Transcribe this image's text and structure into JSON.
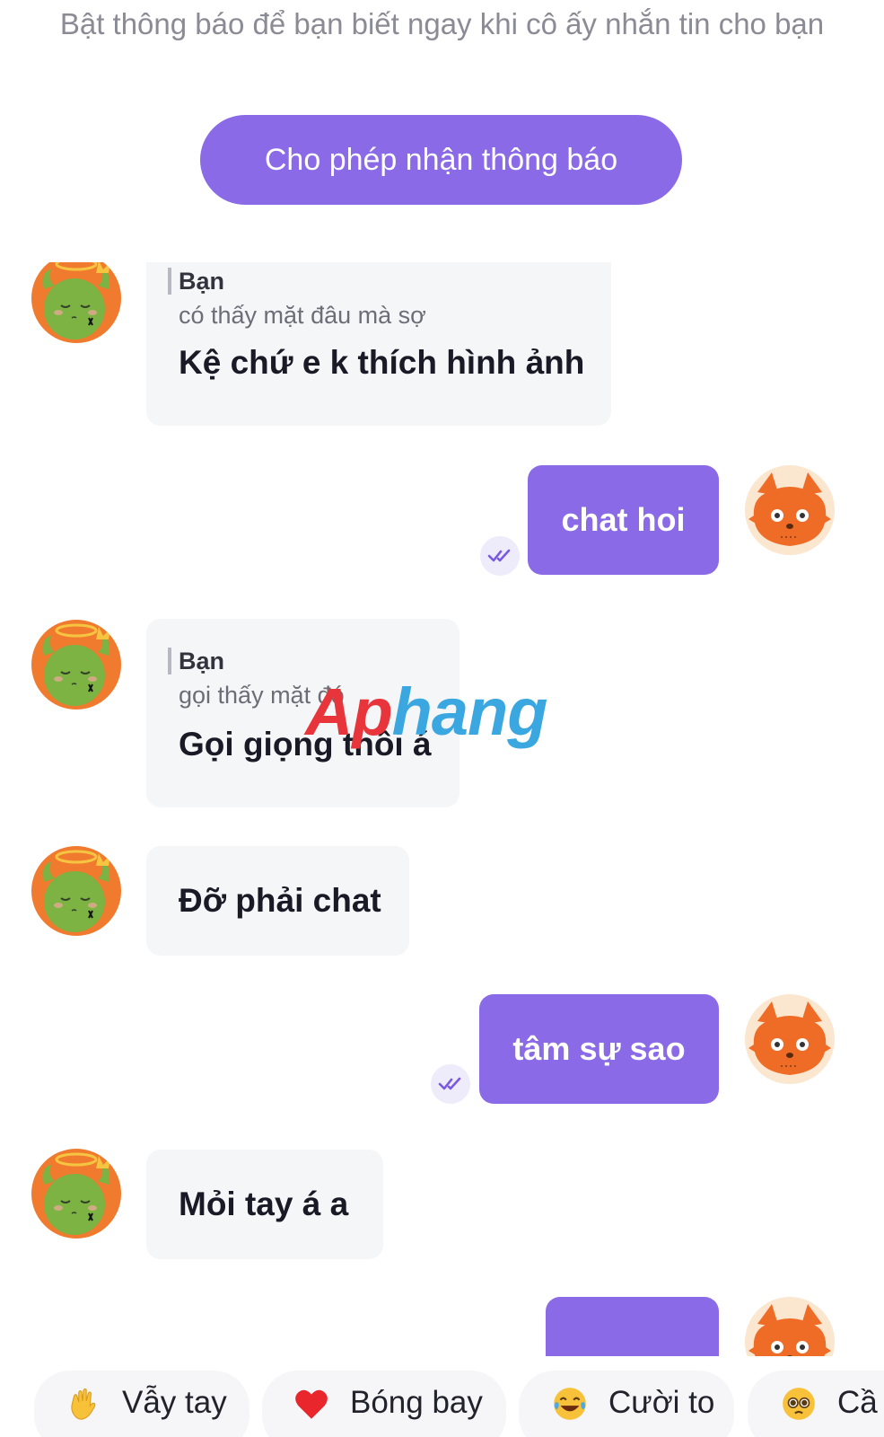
{
  "banner": {
    "text": "Bật thông báo để bạn biết ngay khi cô ấy nhắn tin cho bạn",
    "button_label": "Cho phép nhận thông báo"
  },
  "messages": [
    {
      "side": "in",
      "reply_name": "Bạn",
      "reply_quote": "có thấy mặt đâu mà sợ",
      "text": "Kệ chứ e k thích hình ảnh"
    },
    {
      "side": "out",
      "text": "chat hoi",
      "status": "read"
    },
    {
      "side": "in",
      "reply_name": "Bạn",
      "reply_quote": "gọi thấy mặt đó",
      "text": "Gọi giọng thôi á"
    },
    {
      "side": "in",
      "text": "Đỡ phải chat"
    },
    {
      "side": "out",
      "text": "tâm sự sao",
      "status": "read"
    },
    {
      "side": "in",
      "text": "Mỏi tay á a"
    },
    {
      "side": "out",
      "text": "",
      "status": "partial"
    }
  ],
  "watermark": {
    "part1": "Ap",
    "part2": "hang"
  },
  "quick_replies": [
    {
      "emoji": "waving-hand-icon",
      "label": "Vẫy tay"
    },
    {
      "emoji": "red-heart-icon",
      "label": "Bóng bay"
    },
    {
      "emoji": "tears-of-joy-icon",
      "label": "Cười to"
    },
    {
      "emoji": "pleading-face-icon",
      "label": "Cầ"
    }
  ],
  "colors": {
    "accent": "#8a6ae6",
    "incoming_bubble": "#f5f6f8",
    "banner_text": "#8b8b95"
  }
}
